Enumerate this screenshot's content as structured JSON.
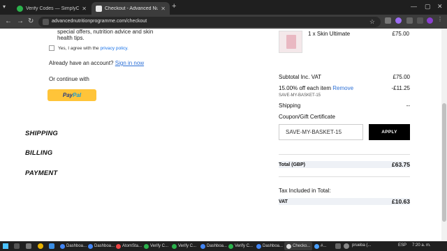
{
  "browser": {
    "tabs": [
      {
        "label": "Verify Codes — SimplyCodes",
        "active": false
      },
      {
        "label": "Checkout - Advanced Nutrition",
        "active": true
      }
    ],
    "url": "advancednutritionprogramme.com/checkout"
  },
  "left": {
    "tips_text": "special offers, nutrition advice and skin health tips.",
    "agree_prefix": "Yes, I agree with the",
    "agree_link": "privacy policy.",
    "account_text": "Already have an account?",
    "sign_in": "Sign in now",
    "or_continue": "Or continue with",
    "paypal_a": "Pay",
    "paypal_b": "Pal",
    "sections": [
      "SHIPPING",
      "BILLING",
      "PAYMENT"
    ]
  },
  "summary": {
    "product_name": "1 x Skin Ultimate",
    "product_price": "£75.00",
    "subtotal_label": "Subtotal Inc. VAT",
    "subtotal_value": "£75.00",
    "discount_label": "15.00% off each item",
    "remove_label": "Remove",
    "discount_value": "-£11.25",
    "discount_code": "SAVE-MY-BASKET-15",
    "shipping_label": "Shipping",
    "shipping_value": "--",
    "coupon_label": "Coupon/Gift Certificate",
    "coupon_value": "SAVE-MY-BASKET-15",
    "apply_label": "APPLY",
    "total_label": "Total (GBP)",
    "total_value": "£63.75",
    "tax_included": "Tax Included in Total:",
    "vat_label": "VAT",
    "vat_value": "£10.63"
  },
  "taskbar": {
    "apps": [
      "Dashboa...",
      "Dashboa...",
      "AtomSta...",
      "Verify C...",
      "Verify C...",
      "Dashboa...",
      "Verify C...",
      "Dashboa...",
      "Checko..."
    ],
    "extra": "#...",
    "search": "prueba (...",
    "lang": "ESP",
    "time": "7:20 a. m."
  },
  "colors": {
    "accent_link": "#2b6fd6",
    "paypal": "#ffc439",
    "apply_bg": "#000000"
  }
}
